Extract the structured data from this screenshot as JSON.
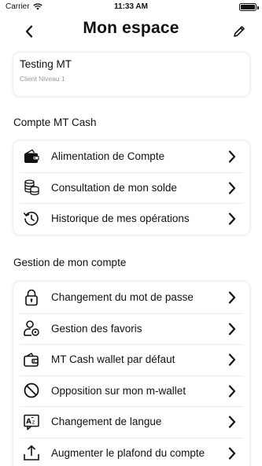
{
  "status_bar": {
    "carrier": "Carrier",
    "time": "11:33 AM"
  },
  "header": {
    "title": "Mon espace"
  },
  "profile": {
    "name": "Testing MT",
    "level": "Client Niveau 1"
  },
  "sections": {
    "cash": {
      "title": "Compte MT Cash",
      "items": [
        {
          "label": "Alimentation de Compte",
          "icon": "wallet-icon"
        },
        {
          "label": "Consultation de mon solde",
          "icon": "coins-icon"
        },
        {
          "label": "Historique de mes opérations",
          "icon": "history-icon"
        }
      ]
    },
    "account": {
      "title": "Gestion de mon compte",
      "items": [
        {
          "label": "Changement du mot de passe",
          "icon": "lock-icon"
        },
        {
          "label": "Gestion des favoris",
          "icon": "user-settings-icon"
        },
        {
          "label": "MT Cash wallet par défaut",
          "icon": "wallet-check-icon"
        },
        {
          "label": "Opposition sur mon m-wallet",
          "icon": "block-icon"
        },
        {
          "label": "Changement de langue",
          "icon": "language-icon"
        },
        {
          "label": "Augmenter le plafond du compte",
          "icon": "upload-icon"
        }
      ]
    }
  }
}
